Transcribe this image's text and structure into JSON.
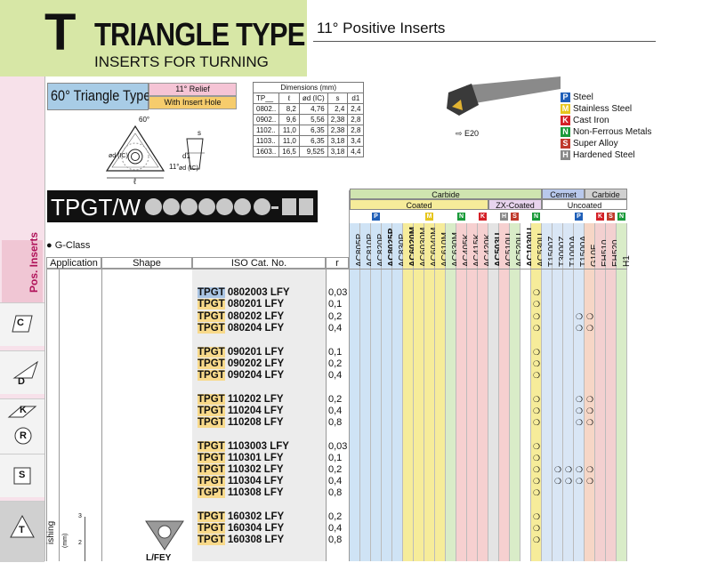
{
  "header": {
    "letter": "T",
    "title": "TRIANGLE TYPE",
    "subtitle": "INSERTS FOR TURNING",
    "right_title": "11° Positive Inserts"
  },
  "sidebar": {
    "pos_inserts": "Pos. Inserts",
    "tabs": [
      {
        "label": "C"
      },
      {
        "label": "D"
      },
      {
        "label": "K"
      },
      {
        "label": "R"
      },
      {
        "label": "S"
      },
      {
        "label": "T"
      }
    ]
  },
  "insert_type": {
    "name": "60° Triangle Type",
    "relief": "11° Relief",
    "hole": "With Insert Hole"
  },
  "drawing": {
    "angle": "60°",
    "relief_angle": "11°",
    "d_ic": "ød (IC)",
    "d1": "d1",
    "s": "s",
    "l": "ℓ",
    "d_ic2": "ød (IC)"
  },
  "dimensions": {
    "title": "Dimensions (mm)",
    "headers": [
      "TP__",
      "ℓ",
      "ød (IC)",
      "s",
      "d1"
    ],
    "rows": [
      [
        "0802..",
        "8,2",
        "4,76",
        "2,4",
        "2,4"
      ],
      [
        "0902..",
        "9,6",
        "5,56",
        "2,38",
        "2,8"
      ],
      [
        "1102..",
        "11,0",
        "6,35",
        "2,38",
        "2,8"
      ],
      [
        "1103..",
        "11,0",
        "6,35",
        "3,18",
        "3,4"
      ],
      [
        "1603..",
        "16,5",
        "9,525",
        "3,18",
        "4,4"
      ]
    ]
  },
  "holder_label": "E20",
  "legend": [
    {
      "code": "P",
      "name": "Steel",
      "color": "#1f5fb8"
    },
    {
      "code": "M",
      "name": "Stainless Steel",
      "color": "#e6c51c"
    },
    {
      "code": "K",
      "name": "Cast Iron",
      "color": "#d42027"
    },
    {
      "code": "N",
      "name": "Non-Ferrous Metals",
      "color": "#1a9a3a"
    },
    {
      "code": "S",
      "name": "Super Alloy",
      "color": "#c0392b"
    },
    {
      "code": "H",
      "name": "Hardened Steel",
      "color": "#888888"
    }
  ],
  "code_bar": {
    "prefix": "TPGT/W"
  },
  "g_class": "G-Class",
  "columns": {
    "application": "Application",
    "shape": "Shape",
    "iso": "ISO Cat. No.",
    "r": "r"
  },
  "application_label": "ishing",
  "chipbreaker": "L/FEY",
  "scale": {
    "unit": "(mm)",
    "t3": "3",
    "t2": "2"
  },
  "grade_groups": {
    "carbide": "Carbide",
    "coated": "Coated",
    "zx": "ZX-Coated",
    "cermet": "Cermet",
    "uncoated": "Uncoated",
    "carbide2": "Carbide"
  },
  "grades": [
    "AC805P",
    "AC810P",
    "AC820P",
    "AC8025P",
    "AC830P",
    "AC6020M",
    "AC6030M",
    "AC6040M",
    "AC610M",
    "AC630M",
    "AC405K",
    "AC415K",
    "AC420K",
    "AC503U",
    "AC510U",
    "AC520U",
    "AC1030U",
    "AC530U",
    "T1500Z",
    "T3000Z",
    "T1000A",
    "T1500A",
    "G10E",
    "EH510",
    "EH520",
    "H1"
  ],
  "inserts": [
    {
      "pre": "TPGT",
      "num": "0802003 LFY",
      "r": "0,03"
    },
    {
      "pre": "TPGT",
      "num": "080201 LFY",
      "r": "0,1"
    },
    {
      "pre": "TPGT",
      "num": "080202 LFY",
      "r": "0,2"
    },
    {
      "pre": "TPGT",
      "num": "080204 LFY",
      "r": "0,4"
    },
    {
      "pre": "TPGT",
      "num": "090201 LFY",
      "r": "0,1"
    },
    {
      "pre": "TPGT",
      "num": "090202 LFY",
      "r": "0,2"
    },
    {
      "pre": "TPGT",
      "num": "090204 LFY",
      "r": "0,4"
    },
    {
      "pre": "TPGT",
      "num": "110202 LFY",
      "r": "0,2"
    },
    {
      "pre": "TPGT",
      "num": "110204 LFY",
      "r": "0,4"
    },
    {
      "pre": "TPGT",
      "num": "110208 LFY",
      "r": "0,8"
    },
    {
      "pre": "TPGT",
      "num": "1103003 LFY",
      "r": "0,03"
    },
    {
      "pre": "TPGT",
      "num": "110301 LFY",
      "r": "0,1"
    },
    {
      "pre": "TPGT",
      "num": "110302 LFY",
      "r": "0,2"
    },
    {
      "pre": "TPGT",
      "num": "110304 LFY",
      "r": "0,4"
    },
    {
      "pre": "TGPT",
      "num": "110308 LFY",
      "r": "0,8"
    },
    {
      "pre": "TPGT",
      "num": "160302 LFY",
      "r": "0,2"
    },
    {
      "pre": "TPGT",
      "num": "160304 LFY",
      "r": "0,4"
    },
    {
      "pre": "TPGT",
      "num": "160308 LFY",
      "r": "0,8"
    }
  ],
  "availability_symbol": "❍"
}
